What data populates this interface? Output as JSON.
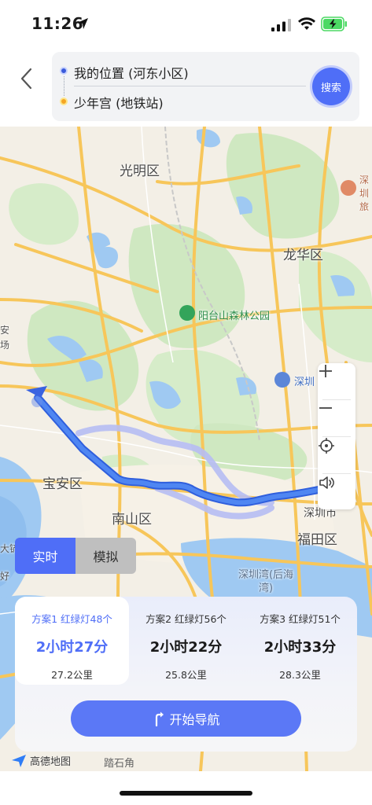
{
  "status_bar": {
    "time": "11:26"
  },
  "header": {
    "start_location": "我的位置 (河东小区)",
    "end_location": "少年宫 (地铁站)",
    "search_label": "搜索"
  },
  "map": {
    "districts": [
      "光明区",
      "龙华区",
      "宝安区",
      "南山区",
      "福田区",
      "深圳市"
    ],
    "pois": {
      "park": "阳台山森林公园",
      "shenzhen_north": "深圳",
      "bay": "深圳湾(后海湾)",
      "edge_left_1": "安",
      "edge_left_2": "场",
      "edge_left_3": "大铲",
      "edge_left_4": "好",
      "edge_right": "深圳旅"
    },
    "colors": {
      "route": "#3b6ee8",
      "alt_route": "#b6bdf3",
      "water": "#9fc9f2",
      "green": "#cfe8c1",
      "road": "#f7c65a"
    }
  },
  "mode_toggle": {
    "realtime": "实时",
    "simulate": "模拟"
  },
  "plans": [
    {
      "head": "方案1 红绿灯48个",
      "time": "2小时27分",
      "distance": "27.2公里",
      "active": true
    },
    {
      "head": "方案2 红绿灯56个",
      "time": "2小时22分",
      "distance": "25.8公里",
      "active": false
    },
    {
      "head": "方案3 红绿灯51个",
      "time": "2小时33分",
      "distance": "28.3公里",
      "active": false
    }
  ],
  "nav_button_label": "开始导航",
  "footer": {
    "logo_text": "高德地图",
    "place": "踏石角"
  }
}
